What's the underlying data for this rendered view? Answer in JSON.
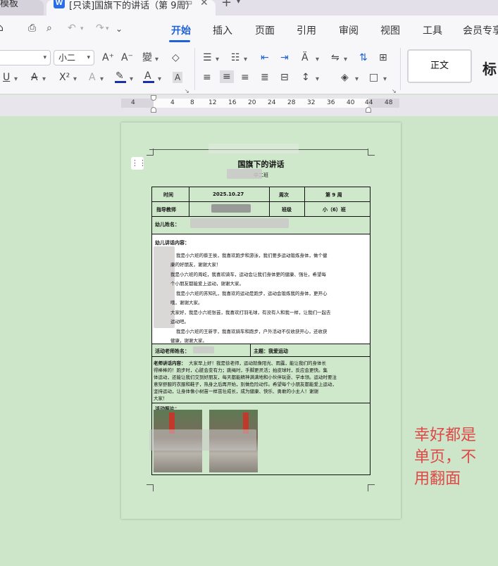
{
  "tabs": {
    "inactive_label": "模板",
    "active_title": "[只读]国旗下的讲话（第 9周）"
  },
  "menu": {
    "items": [
      "开始",
      "插入",
      "页面",
      "引用",
      "审阅",
      "视图",
      "工具",
      "会员专享"
    ],
    "active": "开始"
  },
  "toolbar": {
    "font_size": "小二",
    "style_current": "正文",
    "style_next": "标"
  },
  "ruler": {
    "ticks": [
      "4",
      "4",
      "8",
      "12",
      "16",
      "20",
      "24",
      "28",
      "32",
      "36",
      "40",
      "44",
      "48"
    ]
  },
  "colors": {
    "page_bg": "#cde5c9",
    "accent": "#1d62d8",
    "annotation": "#e04848"
  },
  "document": {
    "title": "国旗下的讲话",
    "subtitle": "中二班",
    "row1": {
      "c1": "时间",
      "c2": "2025.10.27",
      "c3": "周次",
      "c4": "第 9 周"
    },
    "row2": {
      "c1": "指导教师",
      "c3": "班级",
      "c4": "小（6）班"
    },
    "row3_label": "幼儿姓名：",
    "content_label": "幼儿讲话内容：",
    "content_lines": [
      "我是小六班的蔡王侯，我喜欢跑步和游泳，我们要多运动锻炼身体，做个健",
      "康的好朋友，谢谢大家！",
      "我是小六班的周屹，我喜欢骑车，运动会让我们身体更的健康、强壮，希望每",
      "个小朋友都能爱上运动，谢谢大家。",
      "我是小六班的苏知礼，我喜欢的运动是跑步，运动会锻炼我的身体，更开心",
      "哦，谢谢大家。",
      "大家好，我是小六班张芸，我喜欢打羽毛球，有没有人和我一样，让我们一起去",
      "运动吧。",
      "我是小六班的王新宇，我喜欢骑车和跑步，户外活动不仅收获开心，还收获",
      "健康，谢谢大家。"
    ],
    "teacher_label": "活动老师姓名：",
    "theme": "主题：我爱运动",
    "teacher_speech_label": "老师讲话内容：",
    "teacher_speech": [
      "大家早上好！我是徐老师，运动就像阳光、雨露，能让我们的身体长",
      "得棒棒的！跑步时，心脏会变有力；跳绳时，手脚更灵活；拍皮球时，反应会更快。集",
      "体运动，还能让我们交到好朋友，每天都能精神满满地和小伙伴玩耍、学本领。运动时要注",
      "意穿舒服的衣服和鞋子，热身之后再开始，别做危险动作。希望每个小朋友都能爱上运动，",
      "坚持运动，让身体像小树苗一样茁壮成长，成为健康、快乐、勇敢的小主人！谢谢",
      "大家！"
    ],
    "photo_label": "活动照片："
  },
  "annotation": {
    "lines": [
      "幸好都是",
      "单页，不",
      "用翻面"
    ]
  }
}
